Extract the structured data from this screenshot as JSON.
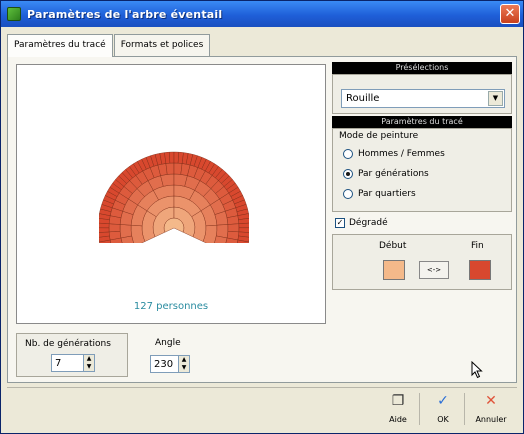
{
  "window": {
    "title": "Paramètres de l'arbre éventail"
  },
  "tabs": [
    {
      "label": "Paramètres du tracé"
    },
    {
      "label": "Formats et polices"
    }
  ],
  "canvas": {
    "count_text": "127 personnes"
  },
  "generations": {
    "label": "Nb. de générations",
    "value": "7"
  },
  "angle": {
    "label": "Angle",
    "value": "230"
  },
  "presets": {
    "header": "Présélections",
    "selected": "Rouille"
  },
  "style": {
    "header": "Paramètres du tracé",
    "mode_label": "Mode de peinture",
    "options": [
      {
        "label": "Hommes / Femmes",
        "checked": false
      },
      {
        "label": "Par générations",
        "checked": true
      },
      {
        "label": "Par quartiers",
        "checked": false
      }
    ]
  },
  "gradient": {
    "label": "Dégradé",
    "checked": true,
    "start_label": "Début",
    "end_label": "Fin",
    "swap_label": "<->",
    "start_color": "#f4b98a",
    "end_color": "#d8482e"
  },
  "footer": {
    "help": "Aide",
    "ok": "OK",
    "cancel": "Annuler"
  },
  "icons": {
    "close": "close-icon",
    "help": "help-icon",
    "ok": "check-icon",
    "cancel": "cross-icon",
    "cursor": "mouse-cursor-icon"
  }
}
